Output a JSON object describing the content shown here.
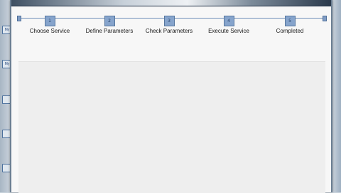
{
  "wizard": {
    "steps": [
      {
        "number": "1",
        "label": "Choose Service"
      },
      {
        "number": "2",
        "label": "Define Parameters"
      },
      {
        "number": "3",
        "label": "Check Parameters"
      },
      {
        "number": "4",
        "label": "Execute Service"
      },
      {
        "number": "5",
        "label": "Completed"
      }
    ]
  },
  "desktop": {
    "icons": [
      "My",
      "My",
      "",
      "",
      ""
    ]
  },
  "colors": {
    "rail": "#6f8fb8",
    "step_box": "#86a4cc",
    "panel": "#eeeeee"
  }
}
